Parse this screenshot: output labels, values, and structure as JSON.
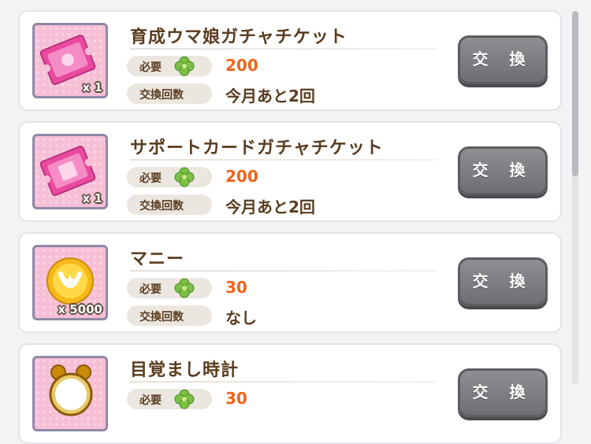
{
  "labels": {
    "required": "必要",
    "exchange_count": "交換回数",
    "exchange_button": "交 換"
  },
  "items": [
    {
      "name": "育成ウマ娘ガチャチケット",
      "quantity": "x 1",
      "cost": "200",
      "limit": "今月あと2回",
      "icon": "ticket-pink-icon"
    },
    {
      "name": "サポートカードガチャチケット",
      "quantity": "x 1",
      "cost": "200",
      "limit": "今月あと2回",
      "icon": "ticket-pink-icon"
    },
    {
      "name": "マニー",
      "quantity": "x 5000",
      "cost": "30",
      "limit": "なし",
      "icon": "money-coin-icon"
    },
    {
      "name": "目覚まし時計",
      "quantity": "",
      "cost": "30",
      "limit": "",
      "icon": "alarm-clock-icon"
    }
  ],
  "colors": {
    "cost": "#f0631b",
    "text": "#5a3c1e",
    "button": "#7e7e83"
  }
}
